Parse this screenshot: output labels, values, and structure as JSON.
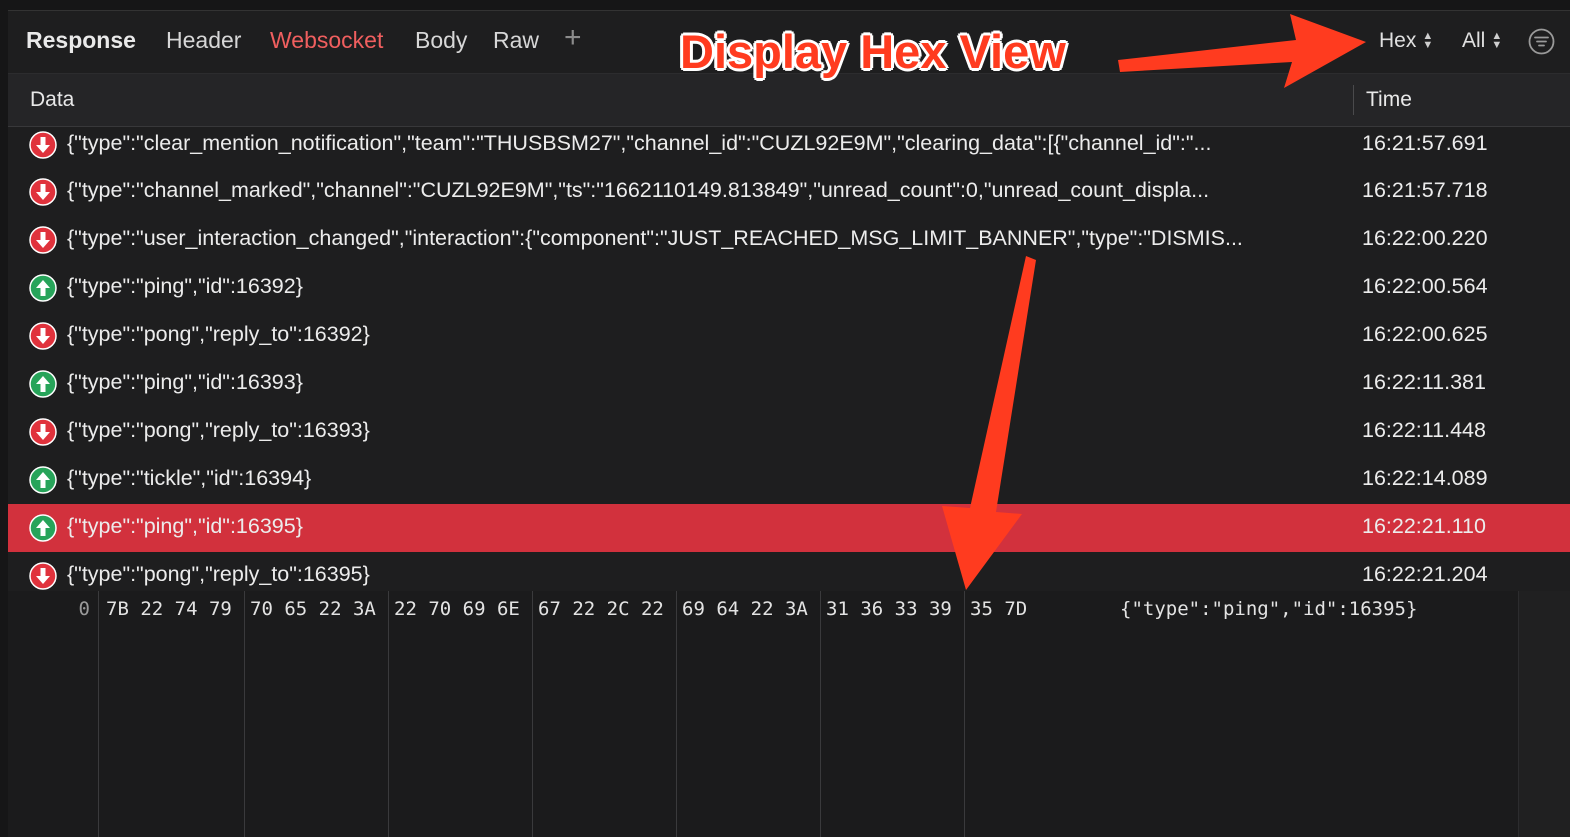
{
  "toolbar": {
    "title": "Response",
    "tabs": [
      "Header",
      "Websocket",
      "Body",
      "Raw"
    ],
    "active_tab": "Websocket",
    "add_label": "+",
    "format_select": "Hex",
    "filter_select": "All"
  },
  "columns": {
    "data": "Data",
    "time": "Time"
  },
  "messages": [
    {
      "dir": "down",
      "data": "{\"type\":\"clear_mention_notification\",\"team\":\"THUSBSM27\",\"channel_id\":\"CUZL92E9M\",\"clearing_data\":[{\"channel_id\":\"...",
      "time": "16:21:57.691"
    },
    {
      "dir": "down",
      "data": "{\"type\":\"channel_marked\",\"channel\":\"CUZL92E9M\",\"ts\":\"1662110149.813849\",\"unread_count\":0,\"unread_count_displa...",
      "time": "16:21:57.718"
    },
    {
      "dir": "down",
      "data": "{\"type\":\"user_interaction_changed\",\"interaction\":{\"component\":\"JUST_REACHED_MSG_LIMIT_BANNER\",\"type\":\"DISMIS...",
      "time": "16:22:00.220"
    },
    {
      "dir": "up",
      "data": "{\"type\":\"ping\",\"id\":16392}",
      "time": "16:22:00.564"
    },
    {
      "dir": "down",
      "data": "{\"type\":\"pong\",\"reply_to\":16392}",
      "time": "16:22:00.625"
    },
    {
      "dir": "up",
      "data": "{\"type\":\"ping\",\"id\":16393}",
      "time": "16:22:11.381"
    },
    {
      "dir": "down",
      "data": "{\"type\":\"pong\",\"reply_to\":16393}",
      "time": "16:22:11.448"
    },
    {
      "dir": "up",
      "data": "{\"type\":\"tickle\",\"id\":16394}",
      "time": "16:22:14.089"
    },
    {
      "dir": "up",
      "data": "{\"type\":\"ping\",\"id\":16395}",
      "time": "16:22:21.110",
      "selected": true
    },
    {
      "dir": "down",
      "data": "{\"type\":\"pong\",\"reply_to\":16395}",
      "time": "16:22:21.204"
    }
  ],
  "hex_view": {
    "offset": "0",
    "groups": [
      "7B 22 74 79",
      "70 65 22 3A",
      "22 70 69 6E",
      "67 22 2C 22",
      "69 64 22 3A",
      "31 36 33 39",
      "35 7D"
    ],
    "ascii": "{\"type\":\"ping\",\"id\":16395}"
  },
  "annotation": {
    "label": "Display Hex View"
  },
  "colors": {
    "accent": "#f05f5f",
    "selected_row": "#d2313d",
    "incoming": "#e0323c",
    "outgoing": "#27a45a",
    "annotation": "#ff3b1f"
  }
}
